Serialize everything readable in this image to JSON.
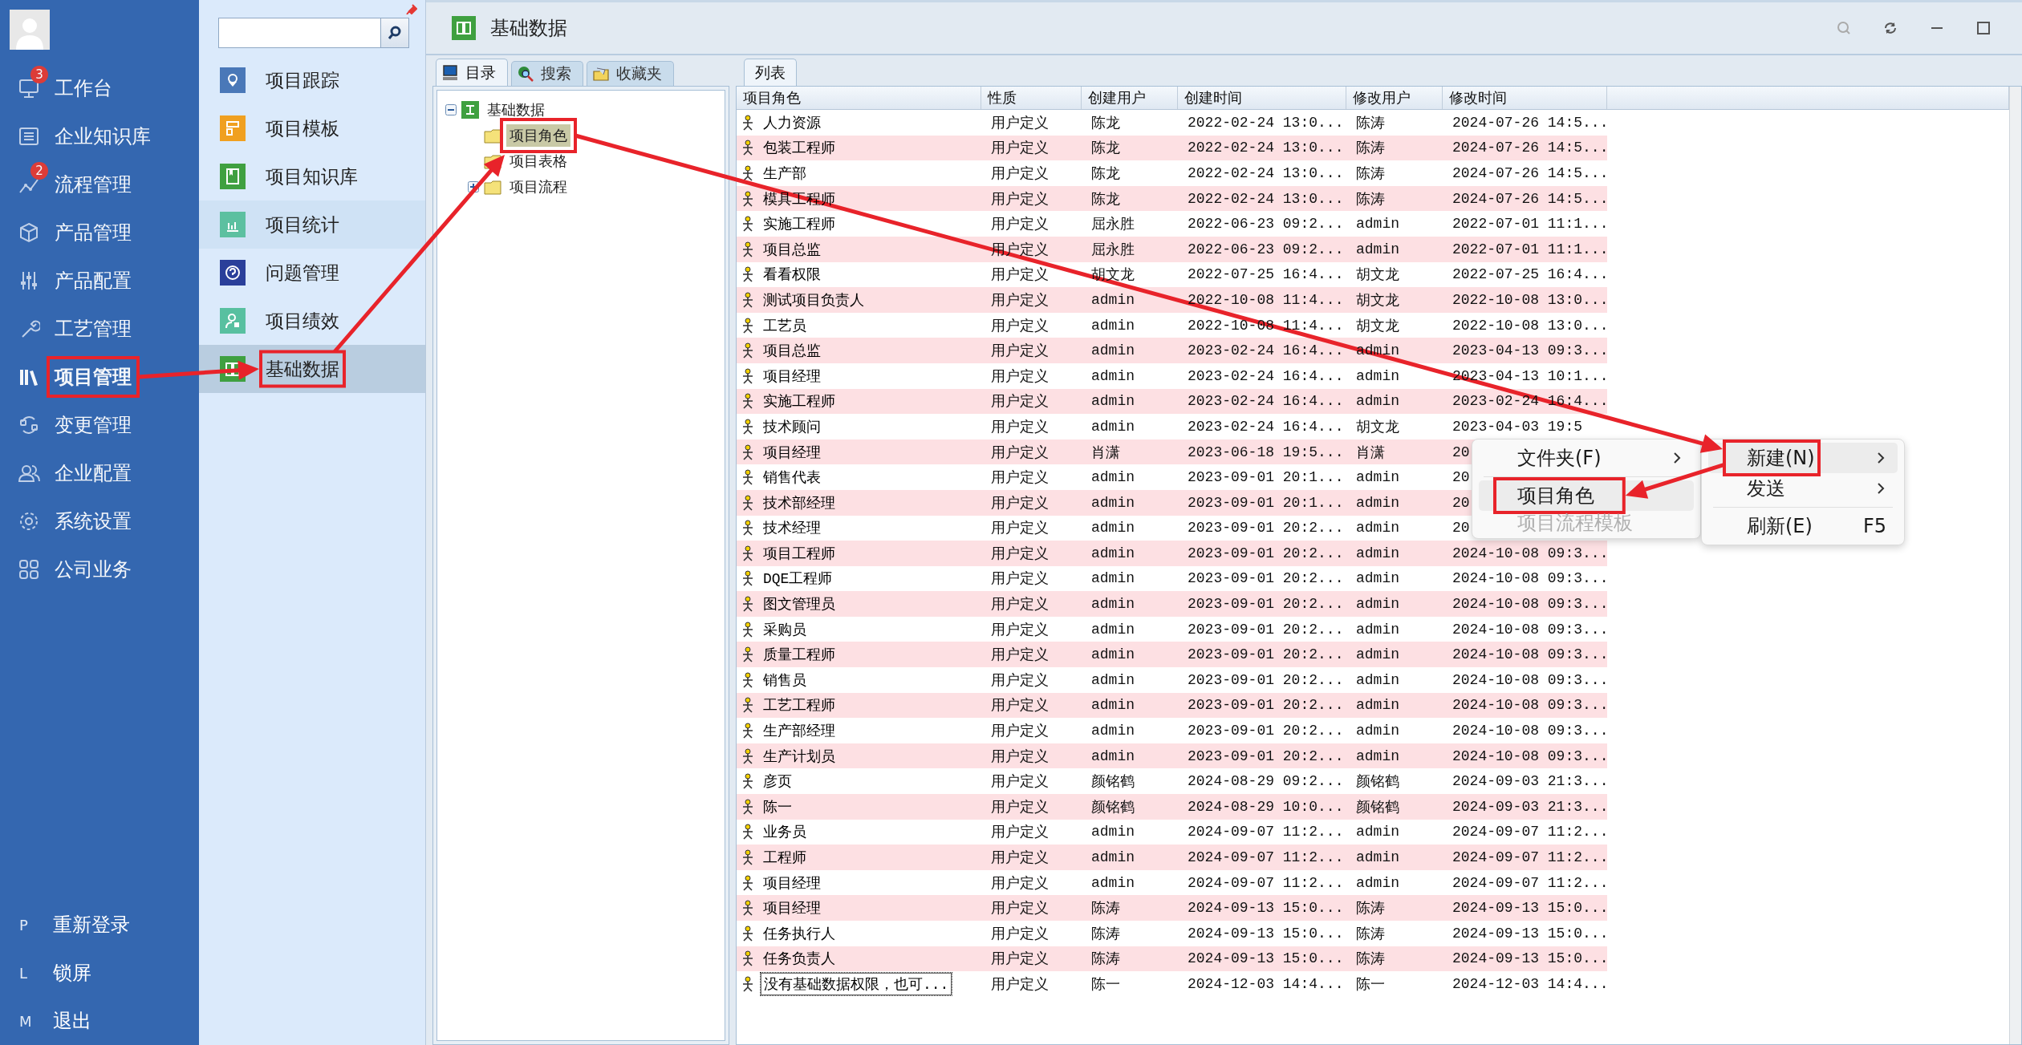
{
  "nav": {
    "items": [
      {
        "label": "工作台",
        "badge": "3",
        "selected": false
      },
      {
        "label": "企业知识库",
        "selected": false
      },
      {
        "label": "流程管理",
        "badge": "2",
        "selected": false
      },
      {
        "label": "产品管理",
        "selected": false
      },
      {
        "label": "产品配置",
        "selected": false
      },
      {
        "label": "工艺管理",
        "selected": false
      },
      {
        "label": "项目管理",
        "selected": true
      },
      {
        "label": "变更管理",
        "selected": false
      },
      {
        "label": "企业配置",
        "selected": false
      },
      {
        "label": "系统设置",
        "selected": false
      },
      {
        "label": "公司业务",
        "selected": false
      }
    ],
    "footer": [
      {
        "key": "P",
        "label": "重新登录"
      },
      {
        "key": "L",
        "label": "锁屏"
      },
      {
        "key": "M",
        "label": "退出"
      }
    ]
  },
  "module_panel": {
    "items": [
      {
        "label": "项目跟踪",
        "color": "#4a78b8",
        "selected": false,
        "hovered": false
      },
      {
        "label": "项目模板",
        "color": "#f0a020",
        "selected": false,
        "hovered": false
      },
      {
        "label": "项目知识库",
        "color": "#3fa040",
        "selected": false,
        "hovered": false
      },
      {
        "label": "项目统计",
        "color": "#5cc0a0",
        "selected": false,
        "hovered": true
      },
      {
        "label": "问题管理",
        "color": "#2a3f9a",
        "selected": false,
        "hovered": false
      },
      {
        "label": "项目绩效",
        "color": "#58c0a0",
        "selected": false,
        "hovered": false
      },
      {
        "label": "基础数据",
        "color": "#3fa040",
        "selected": true,
        "hovered": false
      }
    ]
  },
  "window": {
    "title": "基础数据"
  },
  "left_tabs": [
    {
      "label": "目录",
      "selected": true
    },
    {
      "label": "搜索",
      "selected": false
    },
    {
      "label": "收藏夹",
      "selected": false
    }
  ],
  "tree": {
    "label": "基础数据",
    "expanded": true,
    "children": [
      {
        "label": "项目角色",
        "selected": true,
        "expandable": false
      },
      {
        "label": "项目表格",
        "selected": false,
        "expandable": false
      },
      {
        "label": "项目流程",
        "selected": false,
        "expandable": true
      }
    ]
  },
  "list_tab": {
    "label": "列表",
    "selected": true
  },
  "table": {
    "columns": [
      "项目角色",
      "性质",
      "创建用户",
      "创建时间",
      "修改用户",
      "修改时间"
    ],
    "rows": [
      {
        "cells": [
          "人力资源",
          "用户定义",
          "陈龙",
          "2022-02-24 13:0...",
          "陈涛",
          "2024-07-26 14:5..."
        ],
        "focused": false
      },
      {
        "cells": [
          "包装工程师",
          "用户定义",
          "陈龙",
          "2022-02-24 13:0...",
          "陈涛",
          "2024-07-26 14:5..."
        ],
        "focused": false
      },
      {
        "cells": [
          "生产部",
          "用户定义",
          "陈龙",
          "2022-02-24 13:0...",
          "陈涛",
          "2024-07-26 14:5..."
        ],
        "focused": false
      },
      {
        "cells": [
          "模具工程师",
          "用户定义",
          "陈龙",
          "2022-02-24 13:0...",
          "陈涛",
          "2024-07-26 14:5..."
        ],
        "focused": false
      },
      {
        "cells": [
          "实施工程师",
          "用户定义",
          "屈永胜",
          "2022-06-23 09:2...",
          "admin",
          "2022-07-01 11:1..."
        ],
        "focused": false
      },
      {
        "cells": [
          "项目总监",
          "用户定义",
          "屈永胜",
          "2022-06-23 09:2...",
          "admin",
          "2022-07-01 11:1..."
        ],
        "focused": false
      },
      {
        "cells": [
          "看看权限",
          "用户定义",
          "胡文龙",
          "2022-07-25 16:4...",
          "胡文龙",
          "2022-07-25 16:4..."
        ],
        "focused": false
      },
      {
        "cells": [
          "测试项目负责人",
          "用户定义",
          "admin",
          "2022-10-08 11:4...",
          "胡文龙",
          "2022-10-08 13:0..."
        ],
        "focused": false
      },
      {
        "cells": [
          "工艺员",
          "用户定义",
          "admin",
          "2022-10-08 11:4...",
          "胡文龙",
          "2022-10-08 13:0..."
        ],
        "focused": false
      },
      {
        "cells": [
          "项目总监",
          "用户定义",
          "admin",
          "2023-02-24 16:4...",
          "admin",
          "2023-04-13 09:3..."
        ],
        "focused": false
      },
      {
        "cells": [
          "项目经理",
          "用户定义",
          "admin",
          "2023-02-24 16:4...",
          "admin",
          "2023-04-13 10:1..."
        ],
        "focused": false
      },
      {
        "cells": [
          "实施工程师",
          "用户定义",
          "admin",
          "2023-02-24 16:4...",
          "admin",
          "2023-02-24 16:4..."
        ],
        "focused": false
      },
      {
        "cells": [
          "技术顾问",
          "用户定义",
          "admin",
          "2023-02-24 16:4...",
          "胡文龙",
          "2023-04-03 19:5"
        ],
        "focused": false
      },
      {
        "cells": [
          "项目经理",
          "用户定义",
          "肖潇",
          "2023-06-18 19:5...",
          "肖潇",
          "20"
        ],
        "focused": false
      },
      {
        "cells": [
          "销售代表",
          "用户定义",
          "admin",
          "2023-09-01 20:1...",
          "admin",
          "20"
        ],
        "focused": false
      },
      {
        "cells": [
          "技术部经理",
          "用户定义",
          "admin",
          "2023-09-01 20:1...",
          "admin",
          "20"
        ],
        "focused": false
      },
      {
        "cells": [
          "技术经理",
          "用户定义",
          "admin",
          "2023-09-01 20:2...",
          "admin",
          "20"
        ],
        "focused": false
      },
      {
        "cells": [
          "项目工程师",
          "用户定义",
          "admin",
          "2023-09-01 20:2...",
          "admin",
          "2024-10-08 09:3..."
        ],
        "focused": false
      },
      {
        "cells": [
          "DQE工程师",
          "用户定义",
          "admin",
          "2023-09-01 20:2...",
          "admin",
          "2024-10-08 09:3..."
        ],
        "focused": false
      },
      {
        "cells": [
          "图文管理员",
          "用户定义",
          "admin",
          "2023-09-01 20:2...",
          "admin",
          "2024-10-08 09:3..."
        ],
        "focused": false
      },
      {
        "cells": [
          "采购员",
          "用户定义",
          "admin",
          "2023-09-01 20:2...",
          "admin",
          "2024-10-08 09:3..."
        ],
        "focused": false
      },
      {
        "cells": [
          "质量工程师",
          "用户定义",
          "admin",
          "2023-09-01 20:2...",
          "admin",
          "2024-10-08 09:3..."
        ],
        "focused": false
      },
      {
        "cells": [
          "销售员",
          "用户定义",
          "admin",
          "2023-09-01 20:2...",
          "admin",
          "2024-10-08 09:3..."
        ],
        "focused": false
      },
      {
        "cells": [
          "工艺工程师",
          "用户定义",
          "admin",
          "2023-09-01 20:2...",
          "admin",
          "2024-10-08 09:3..."
        ],
        "focused": false
      },
      {
        "cells": [
          "生产部经理",
          "用户定义",
          "admin",
          "2023-09-01 20:2...",
          "admin",
          "2024-10-08 09:3..."
        ],
        "focused": false
      },
      {
        "cells": [
          "生产计划员",
          "用户定义",
          "admin",
          "2023-09-01 20:2...",
          "admin",
          "2024-10-08 09:3..."
        ],
        "focused": false
      },
      {
        "cells": [
          "彦页",
          "用户定义",
          "颜铭鹤",
          "2024-08-29 09:2...",
          "颜铭鹤",
          "2024-09-03 21:3..."
        ],
        "focused": false
      },
      {
        "cells": [
          "陈一",
          "用户定义",
          "颜铭鹤",
          "2024-08-29 10:0...",
          "颜铭鹤",
          "2024-09-03 21:3..."
        ],
        "focused": false
      },
      {
        "cells": [
          "业务员",
          "用户定义",
          "admin",
          "2024-09-07 11:2...",
          "admin",
          "2024-09-07 11:2..."
        ],
        "focused": false
      },
      {
        "cells": [
          "工程师",
          "用户定义",
          "admin",
          "2024-09-07 11:2...",
          "admin",
          "2024-09-07 11:2..."
        ],
        "focused": false
      },
      {
        "cells": [
          "项目经理",
          "用户定义",
          "admin",
          "2024-09-07 11:2...",
          "admin",
          "2024-09-07 11:2..."
        ],
        "focused": false
      },
      {
        "cells": [
          "项目经理",
          "用户定义",
          "陈涛",
          "2024-09-13 15:0...",
          "陈涛",
          "2024-09-13 15:0..."
        ],
        "focused": false
      },
      {
        "cells": [
          "任务执行人",
          "用户定义",
          "陈涛",
          "2024-09-13 15:0...",
          "陈涛",
          "2024-09-13 15:0..."
        ],
        "focused": false
      },
      {
        "cells": [
          "任务负责人",
          "用户定义",
          "陈涛",
          "2024-09-13 15:0...",
          "陈涛",
          "2024-09-13 15:0..."
        ],
        "focused": false
      },
      {
        "cells": [
          "没有基础数据权限，也可...",
          "用户定义",
          "陈一",
          "2024-12-03 14:4...",
          "陈一",
          "2024-12-03 14:4..."
        ],
        "focused": true
      }
    ]
  },
  "context_menu": {
    "items": [
      {
        "kind": "submenu",
        "label": "文件夹(F)",
        "selected": false,
        "disabled": false
      },
      {
        "kind": "separator"
      },
      {
        "kind": "item",
        "label": "项目角色",
        "selected": true,
        "disabled": false
      },
      {
        "kind": "item",
        "label": "项目流程模板",
        "selected": false,
        "disabled": true
      }
    ]
  },
  "submenu": {
    "items": [
      {
        "kind": "submenu",
        "label": "新建(N)",
        "selected": true,
        "disabled": false
      },
      {
        "kind": "submenu",
        "label": "发送",
        "selected": false,
        "disabled": false
      },
      {
        "kind": "separator"
      },
      {
        "kind": "item",
        "label": "刷新(E)",
        "shortcut": "F5",
        "selected": false,
        "disabled": false
      }
    ]
  }
}
